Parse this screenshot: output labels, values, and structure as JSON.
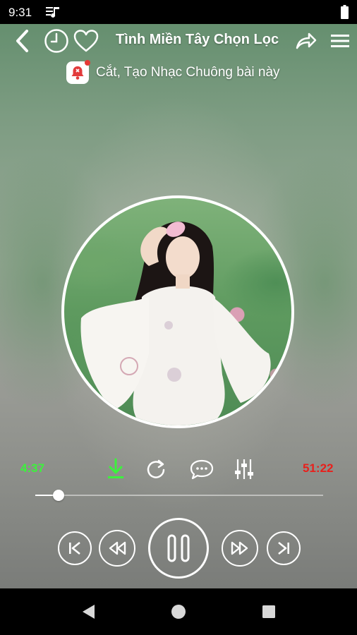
{
  "status_bar": {
    "time": "9:31",
    "icons": [
      "music-notification-icon",
      "battery-icon"
    ]
  },
  "player": {
    "title": "Tình Miền Tây Chọn Lọc",
    "ringtone_label": "Cắt, Tạo Nhạc Chuông bài này",
    "elapsed": "4:37",
    "total": "51:22",
    "progress_fraction": 0.08,
    "elapsed_color": "#3cf23c",
    "total_color": "#e8201c",
    "state": "playing",
    "toolbar_icons": [
      "back-arrow-icon",
      "timer-icon",
      "heart-icon",
      "share-icon",
      "menu-icon"
    ],
    "action_icons": [
      "download-icon",
      "repeat-icon",
      "comment-icon",
      "equalizer-icon"
    ],
    "control_icons": [
      "previous-track-icon",
      "rewind-icon",
      "pause-icon",
      "fast-forward-icon",
      "next-track-icon"
    ],
    "download_color": "#3cf23c"
  },
  "nav_bar": {
    "icons": [
      "nav-back-icon",
      "nav-home-icon",
      "nav-recents-icon"
    ]
  }
}
